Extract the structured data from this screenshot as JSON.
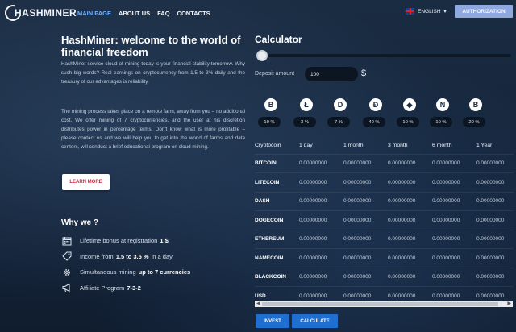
{
  "header": {
    "logo_text": "HASHMINER",
    "nav": [
      "MAIN PAGE",
      "ABOUT US",
      "FAQ",
      "CONTACTS"
    ],
    "active_nav": "MAIN PAGE",
    "language": "ENGLISH",
    "auth_label": "AUTHORIZATION"
  },
  "hero": {
    "title": "HashMiner: welcome to the world of financial freedom",
    "paragraph1": "HashMiner service cloud of mining today is your financial stability tomorrow. Why such big words? Real earnings on cryptocurrency from 1.5 to 3% daily and the treasury of our advantages is reliability.",
    "paragraph2": "The mining process takes place on a remote farm, away from you – no additional cost. We offer mining of 7 cryptocurrencies, and the user at his discretion distributes power in percentage terms. Don't know what is more profitable – please contact us and we will help you to get into the world of farms and data centers, will conduct a brief educational program on cloud mining.",
    "learn_more": "LEARN MORE"
  },
  "why": {
    "title": "Why we ?",
    "items": [
      {
        "icon": "calendar-icon",
        "text": "Lifetime bonus at registration",
        "bold": "1 $"
      },
      {
        "icon": "tag-icon",
        "text": "Income from",
        "bold": "1.5 to 3.5 %",
        "suffix": "in a day"
      },
      {
        "icon": "gear-icon",
        "text": "Simultaneous mining",
        "bold": "up to 7 currencies"
      },
      {
        "icon": "megaphone-icon",
        "text": "Affiliate Program",
        "bold": "7-3-2"
      }
    ]
  },
  "calculator": {
    "title": "Calculator",
    "slider_value": 0,
    "deposit_label": "Deposit amount",
    "deposit_value": "100",
    "currency_symbol": "$",
    "coins": [
      {
        "symbol": "B",
        "icon": "bitcoin-icon",
        "percent": "10 %"
      },
      {
        "symbol": "Ł",
        "icon": "litecoin-icon",
        "percent": "3 %"
      },
      {
        "symbol": "D",
        "icon": "dash-icon",
        "percent": "7 %"
      },
      {
        "symbol": "Ð",
        "icon": "dogecoin-icon",
        "percent": "40 %"
      },
      {
        "symbol": "◆",
        "icon": "ethereum-icon",
        "percent": "10 %"
      },
      {
        "symbol": "N",
        "icon": "namecoin-icon",
        "percent": "10 %"
      },
      {
        "symbol": "B",
        "icon": "blackcoin-icon",
        "percent": "20 %"
      }
    ],
    "columns": [
      "Cryptocoin",
      "1 day",
      "1 month",
      "3 month",
      "6 month",
      "1 Year"
    ],
    "rows": [
      {
        "name": "BITCOIN",
        "values": [
          "0.00000000",
          "0.00000000",
          "0.00000000",
          "0.00000000",
          "0.00000000"
        ]
      },
      {
        "name": "LITECOIN",
        "values": [
          "0.00000000",
          "0.00000000",
          "0.00000000",
          "0.00000000",
          "0.00000000"
        ]
      },
      {
        "name": "DASH",
        "values": [
          "0.00000000",
          "0.00000000",
          "0.00000000",
          "0.00000000",
          "0.00000000"
        ]
      },
      {
        "name": "DOGECOIN",
        "values": [
          "0.00000000",
          "0.00000000",
          "0.00000000",
          "0.00000000",
          "0.00000000"
        ]
      },
      {
        "name": "ETHEREUM",
        "values": [
          "0.00000000",
          "0.00000000",
          "0.00000000",
          "0.00000000",
          "0.00000000"
        ]
      },
      {
        "name": "NAMECOIN",
        "values": [
          "0.00000000",
          "0.00000000",
          "0.00000000",
          "0.00000000",
          "0.00000000"
        ]
      },
      {
        "name": "BLACKCOIN",
        "values": [
          "0.00000000",
          "0.00000000",
          "0.00000000",
          "0.00000000",
          "0.00000000"
        ]
      },
      {
        "name": "USD",
        "values": [
          "0.00000000",
          "0.00000000",
          "0.00000000",
          "0.00000000",
          "0.00000000"
        ]
      }
    ],
    "invest_label": "INVEST",
    "calculate_label": "CALCULATE"
  },
  "colors": {
    "background": "#16263a",
    "accent": "#6fb1ff",
    "button_blue": "#1f6fd1",
    "auth_button": "#8fa8e0",
    "learn_more_text": "#d2233a"
  }
}
